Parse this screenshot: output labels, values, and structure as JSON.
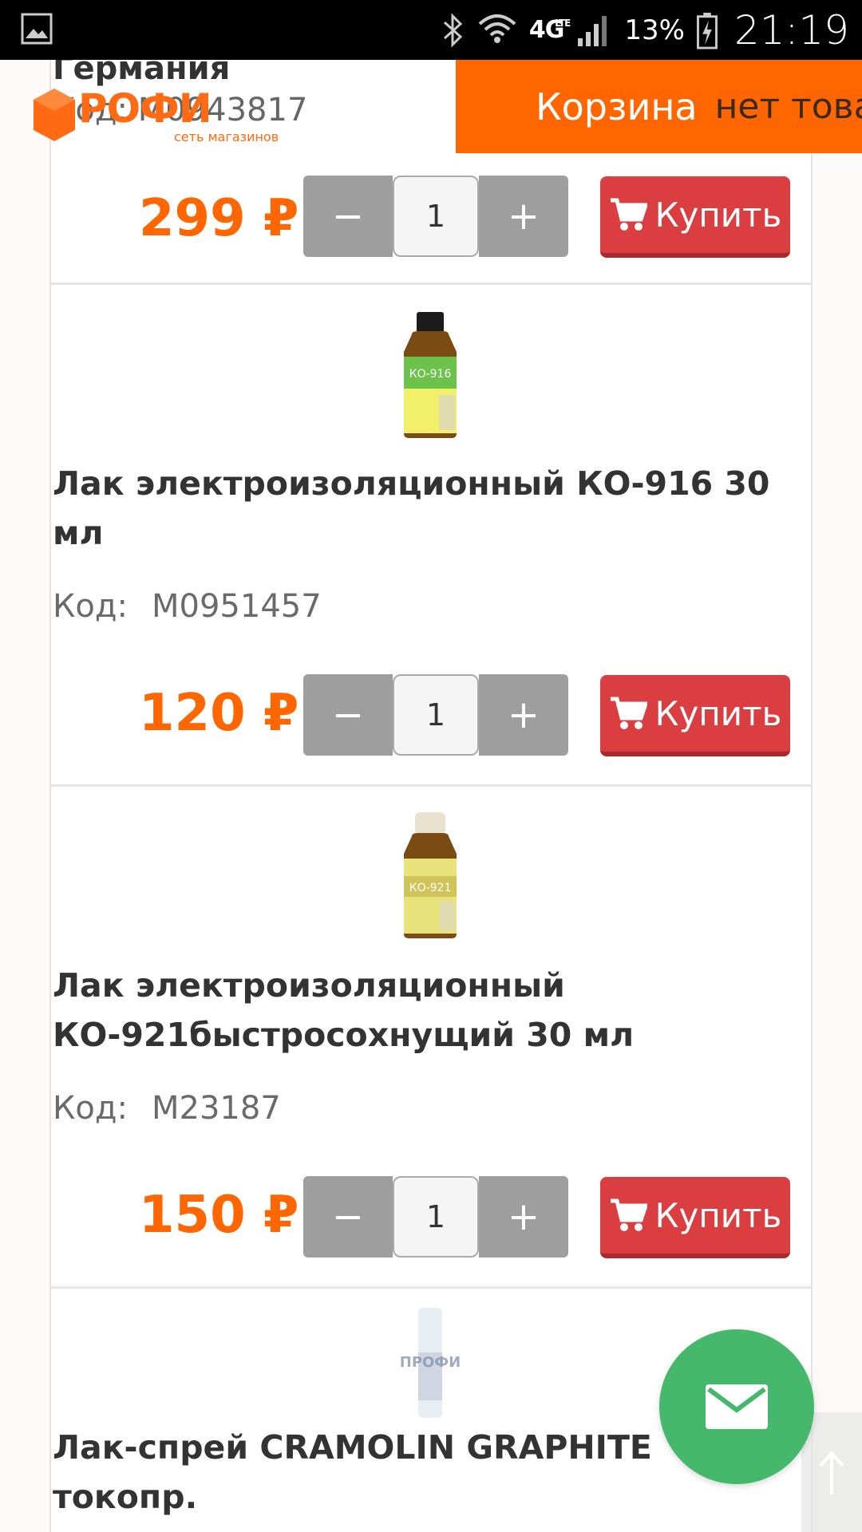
{
  "status_bar": {
    "network": "4G",
    "network_sub": "LTE",
    "battery": "13%",
    "time": "21:19"
  },
  "header": {
    "logo_sub": "сеть магазинов",
    "cart_label": "Корзина",
    "cart_status": "нет товаров"
  },
  "partial_item": {
    "title": "Германия",
    "code_label": "Код:",
    "code": "M0943817",
    "price": "299 ₽",
    "qty": "1"
  },
  "products": [
    {
      "title": "Лак электроизоляционный КО-916 30 мл",
      "code_label": "Код:",
      "code": "M0951457",
      "price": "120 ₽",
      "qty": "1",
      "buy_label": "Купить",
      "bottle_label": "КО-916"
    },
    {
      "title": "Лак электроизоляционный КО-921быстросохнущий 30 мл",
      "code_label": "Код:",
      "code": "M23187",
      "price": "150 ₽",
      "qty": "1",
      "buy_label": "Купить",
      "bottle_label": "КО-921"
    },
    {
      "title": "Лак-спрей CRAMOLIN GRAPHITE токопр.",
      "image_label": "ПРОФИ"
    }
  ],
  "buttons": {
    "buy_label": "Купить",
    "minus": "−",
    "plus": "+"
  },
  "colors": {
    "brand_orange": "#ff6600",
    "buy_red": "#da3e40",
    "fab_green": "#45b86b"
  }
}
